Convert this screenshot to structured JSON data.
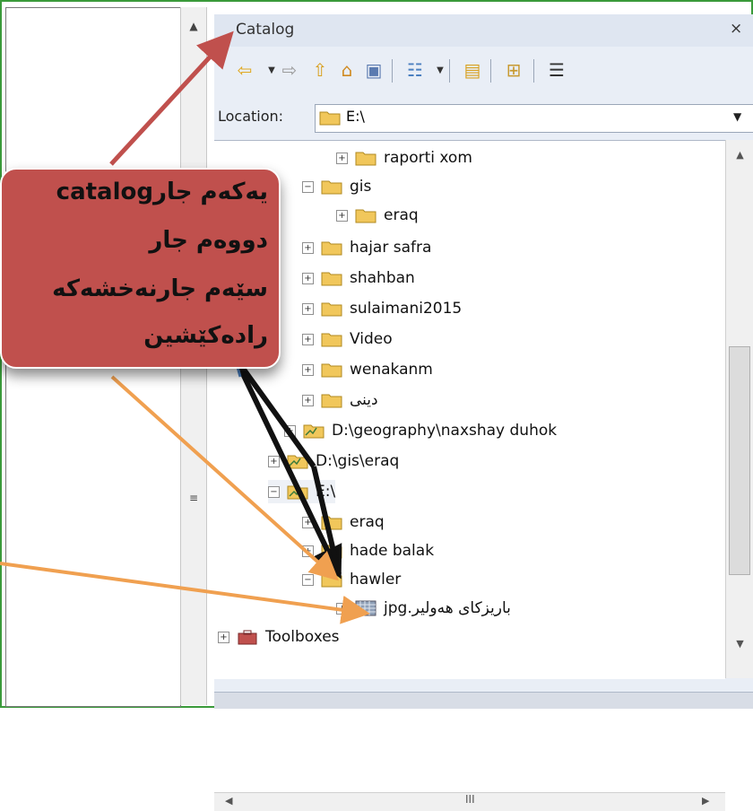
{
  "catalog": {
    "title": "Catalog",
    "pin_glyph": "ᅟ",
    "close_glyph": "×",
    "location_label": "Location:",
    "location_value": "E:\\"
  },
  "tree": {
    "items": [
      {
        "label": "raporti xom",
        "expander": "+"
      },
      {
        "label": "gis",
        "expander": "−"
      },
      {
        "label": "eraq",
        "expander": "+"
      },
      {
        "label": "hajar safra",
        "expander": "+"
      },
      {
        "label": "shahban",
        "expander": "+"
      },
      {
        "label": "sulaimani2015",
        "expander": "+"
      },
      {
        "label": "Video",
        "expander": "+"
      },
      {
        "label": "wenakanm",
        "expander": "+"
      },
      {
        "label": "دینی",
        "expander": "+"
      },
      {
        "label": "D:\\geography\\naxshay duhok",
        "expander": "+"
      },
      {
        "label": "D:\\gis\\eraq",
        "expander": "+"
      },
      {
        "label": "E:\\",
        "expander": "−"
      },
      {
        "label": "eraq",
        "expander": "+"
      },
      {
        "label": "hade balak",
        "expander": "+"
      },
      {
        "label": "hawler",
        "expander": "−"
      },
      {
        "label": "باریزکای هەولیر.jpg",
        "expander": "+"
      },
      {
        "label": "Toolboxes",
        "expander": "+"
      }
    ]
  },
  "hscroll": {
    "grip": "III"
  },
  "callout": {
    "line1": "یەکەم جارcatalog",
    "line2": "دووەم جار",
    "line3": "سێەم جارنەخشەکە",
    "line4": "رادەکێشین"
  },
  "colors": {
    "callout_fill": "#c0504d",
    "frame_green": "#3a9a3a",
    "folder_yellow": "#f1c75b",
    "arrow_red": "#c0504d",
    "arrow_orange": "#f0a050",
    "arrow_black": "#111111",
    "arrow_blue": "#4a7fc0"
  }
}
